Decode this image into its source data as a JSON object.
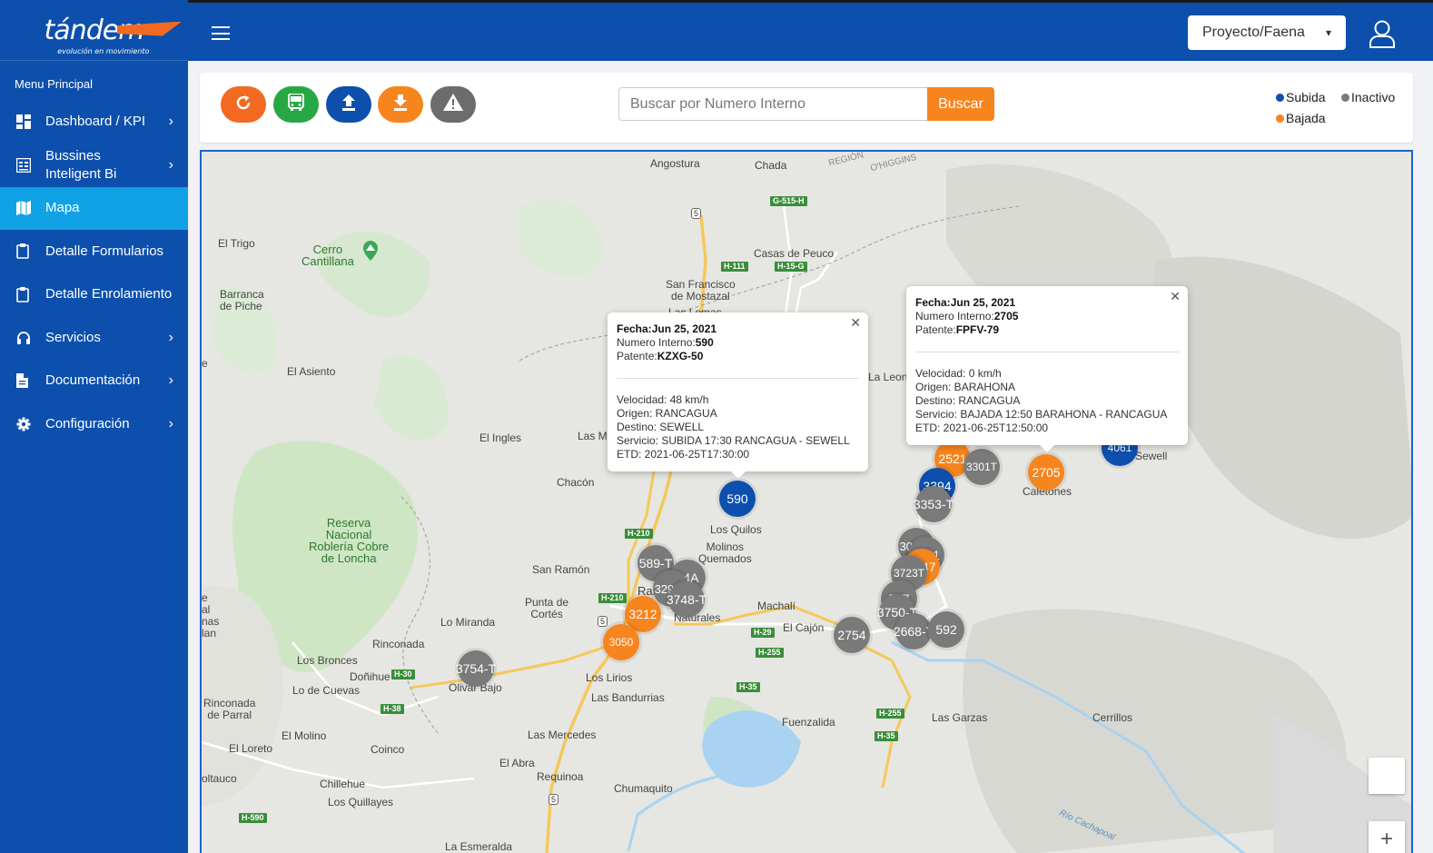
{
  "brand": {
    "name": "tándem",
    "tagline": "evolución en movimiento"
  },
  "sidebar": {
    "menu_title": "Menu Principal",
    "items": [
      {
        "label": "Dashboard / KPI",
        "icon": "dashboard-icon",
        "has_submenu": true,
        "active": false
      },
      {
        "label": "Bussines Inteligent Bi",
        "icon": "report-icon",
        "has_submenu": true,
        "active": false
      },
      {
        "label": "Mapa",
        "icon": "map-icon",
        "has_submenu": false,
        "active": true
      },
      {
        "label": "Detalle Formularios",
        "icon": "clipboard-icon",
        "has_submenu": false,
        "active": false
      },
      {
        "label": "Detalle Enrolamiento",
        "icon": "clipboard-icon",
        "has_submenu": false,
        "active": false
      },
      {
        "label": "Servicios",
        "icon": "headphones-icon",
        "has_submenu": true,
        "active": false
      },
      {
        "label": "Documentación",
        "icon": "document-icon",
        "has_submenu": true,
        "active": false
      },
      {
        "label": "Configuración",
        "icon": "gear-icon",
        "has_submenu": true,
        "active": false
      }
    ]
  },
  "header": {
    "project_select": "Proyecto/Faena"
  },
  "toolbar": {
    "buttons": [
      {
        "name": "refresh-button",
        "icon": "refresh-icon",
        "color": "#f26a21"
      },
      {
        "name": "bus-button",
        "icon": "bus-icon",
        "color": "#27a844"
      },
      {
        "name": "upload-button",
        "icon": "upload-icon",
        "color": "#0d4fad"
      },
      {
        "name": "download-button",
        "icon": "download-icon",
        "color": "#f7851e"
      },
      {
        "name": "warning-button",
        "icon": "warning-icon",
        "color": "#6c6c6c"
      }
    ],
    "search_placeholder": "Buscar por Numero Interno",
    "search_button": "Buscar"
  },
  "legend": {
    "subida": {
      "label": "Subida",
      "color": "#0d4fad"
    },
    "inactivo": {
      "label": "Inactivo",
      "color": "#7a7a7a"
    },
    "bajada": {
      "label": "Bajada",
      "color": "#f7851e"
    }
  },
  "map": {
    "places": {
      "angostura": "Angostura",
      "chada": "Chada",
      "el_trigo": "El Trigo",
      "cerro_cantillana": "Cerro\nCantillana",
      "casas_de_peuco": "Casas de Peuco",
      "barranca": "Barranca\nde Piche",
      "san_francisco": "San Francisco\nde Mostazal",
      "las_lomas": "Las Lomas",
      "el_asiento": "El Asiento",
      "la_leonera": "La Leonera",
      "el_ingles": "El Ingles",
      "las_m": "Las M",
      "chacon": "Chacón",
      "caletones": "Caletones",
      "sewell": "Sewell",
      "los_quilos": "Los Quilos",
      "reserva": "Reserva\nNacional\nRoblería Cobre\nde Loncha",
      "molinos": "Molinos\nQuemados",
      "san_ramon": "San Ramón",
      "rancagua": "Ran",
      "punta_de_cortes": "Punta de\nCortés",
      "naturales": "de\nNaturales",
      "machali": "Machalí",
      "lo_miranda": "Lo Miranda",
      "el_cajon": "El Cajón",
      "rinconada": "Rinconada",
      "los_bronces": "Los Bronces",
      "donihue": "Doñihue",
      "olivar_bajo": "Olivar Bajo",
      "lo_de_cuevas": "Lo de Cuevas",
      "los_lirios": "Los Lirios",
      "las_bandurrias": "Las Bandurrias",
      "rinconada_de_parral": "Rinconada\nde Parral",
      "fuenzalida": "Fuenzalida",
      "las_garzas": "Las Garzas",
      "cerrillos": "Cerrillos",
      "el_molino": "El Molino",
      "las_mercedes": "Las Mercedes",
      "el_loreto": "El Loreto",
      "coinco": "Coinco",
      "el_abra": "El Abra",
      "requinoa": "Requinoa",
      "chumaquito": "Chumaquito",
      "oltauco": "oltauco",
      "chillehue": "Chillehue",
      "los_quillayes": "Los Quillayes",
      "la_esmeralda": "La Esmeralda",
      "region": "REGIÓN",
      "ohiggins": "O'HIGGINS",
      "rio_cachapoal": "Río Cachapoal",
      "e_left": "e",
      "nal": "e\nal\nnas\nlan"
    },
    "highways": [
      "G-515-H",
      "H-111",
      "H-15-G",
      "H-210",
      "H-210",
      "H-29",
      "H-255",
      "H-30",
      "H-38",
      "H-35",
      "H-255",
      "H-35",
      "H-590"
    ],
    "routes": [
      "5",
      "5",
      "5"
    ],
    "markers": [
      {
        "label": "590",
        "status": "subida"
      },
      {
        "label": "2521",
        "status": "bajada"
      },
      {
        "label": "3301T",
        "status": "inactivo"
      },
      {
        "label": "2705",
        "status": "bajada"
      },
      {
        "label": "4061",
        "status": "subida"
      },
      {
        "label": "3394",
        "status": "subida"
      },
      {
        "label": "3353-T",
        "status": "inactivo"
      },
      {
        "label": "3027T",
        "status": "inactivo"
      },
      {
        "label": "3211",
        "status": "inactivo"
      },
      {
        "label": "2947",
        "status": "bajada"
      },
      {
        "label": "3723T",
        "status": "inactivo"
      },
      {
        "label": "597",
        "status": "inactivo"
      },
      {
        "label": "3750-T",
        "status": "inactivo"
      },
      {
        "label": "2754",
        "status": "inactivo"
      },
      {
        "label": "2668-T",
        "status": "inactivo"
      },
      {
        "label": "592",
        "status": "inactivo"
      },
      {
        "label": "589-T",
        "status": "inactivo"
      },
      {
        "label": "14A",
        "status": "inactivo"
      },
      {
        "label": "3290T",
        "status": "inactivo"
      },
      {
        "label": "3748-T",
        "status": "inactivo"
      },
      {
        "label": "3212",
        "status": "bajada"
      },
      {
        "label": "3050",
        "status": "bajada"
      },
      {
        "label": "3754-T",
        "status": "inactivo"
      }
    ],
    "popups": [
      {
        "fecha_label": "Fecha:",
        "fecha": "Jun 25, 2021",
        "numero_label": "Numero Interno:",
        "numero": "590",
        "patente_label": "Patente:",
        "patente": "KZXG-50",
        "velocidad": "Velocidad: 48 km/h",
        "origen": "Origen: RANCAGUA",
        "destino": "Destino: SEWELL",
        "servicio": "Servicio: SUBIDA 17:30 RANCAGUA - SEWELL",
        "etd": "ETD: 2021-06-25T17:30:00"
      },
      {
        "fecha_label": "Fecha:",
        "fecha": "Jun 25, 2021",
        "numero_label": "Numero Interno:",
        "numero": "2705",
        "patente_label": "Patente:",
        "patente": "FPFV-79",
        "velocidad": "Velocidad: 0 km/h",
        "origen": "Origen: BARAHONA",
        "destino": "Destino: RANCAGUA",
        "servicio": "Servicio: BAJADA 12:50 BARAHONA - RANCAGUA",
        "etd": "ETD: 2021-06-25T12:50:00"
      }
    ],
    "zoom_in": "+"
  }
}
